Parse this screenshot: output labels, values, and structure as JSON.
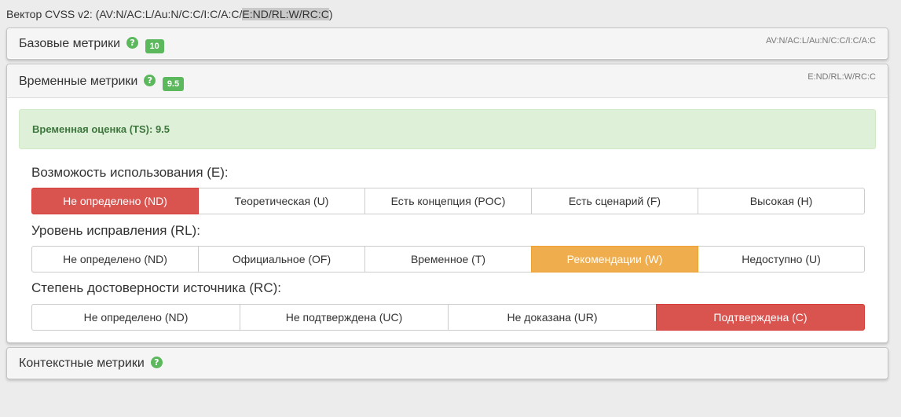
{
  "vector_line": {
    "prefix": "Вектор CVSS v2: (AV:N/AC:L/Au:N/C:C/I:C/A:C/",
    "highlight": "E:ND/RL:W/RC:C",
    "suffix": ")"
  },
  "base_panel": {
    "title": "Базовые метрики",
    "score": "10",
    "vector": "AV:N/AC:L/Au:N/C:C/I:C/A:C"
  },
  "temporal_panel": {
    "title": "Временные метрики",
    "score": "9.5",
    "vector": "E:ND/RL:W/RC:C",
    "alert": "Временная оценка (TS): 9.5",
    "exploitability": {
      "label": "Возможость использования (E):",
      "options": [
        "Не определено (ND)",
        "Теоретическая (U)",
        "Есть концепция (POC)",
        "Есть сценарий (F)",
        "Высокая (H)"
      ],
      "selected": "Не определено (ND)"
    },
    "remediation": {
      "label": "Уровень исправления (RL):",
      "options": [
        "Не определено (ND)",
        "Официальное (OF)",
        "Временное (T)",
        "Рекомендации (W)",
        "Недоступно (U)"
      ],
      "selected": "Рекомендации (W)"
    },
    "confidence": {
      "label": "Степень достоверности источника (RC):",
      "options": [
        "Не определено (ND)",
        "Не подтверждена (UC)",
        "Не доказана (UR)",
        "Подтверждена (C)"
      ],
      "selected": "Подтверждена (C)"
    }
  },
  "environmental_panel": {
    "title": "Контекстные метрики"
  },
  "help_icon_glyph": "?",
  "colors": {
    "success": "#5cb85c",
    "danger": "#d9534f",
    "warning": "#f0ad4e",
    "alert_bg": "#dff0d8"
  }
}
